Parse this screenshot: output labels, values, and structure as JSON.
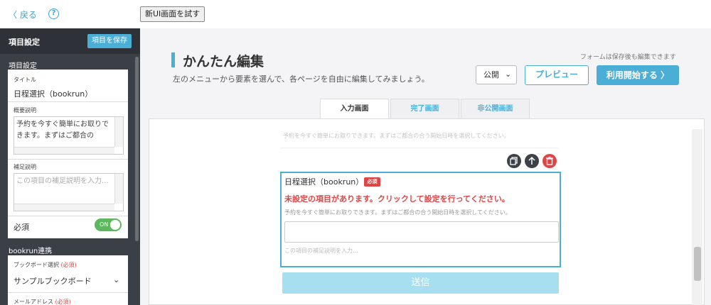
{
  "topbar": {
    "back_label": "〈 戻る",
    "help_icon": "question-circle-icon",
    "new_ui_button": "新UI画面を試す"
  },
  "sidebar": {
    "header_title": "項目設定",
    "save_button": "項目を保存",
    "section_item_settings": "項目設定",
    "title_label": "タイトル",
    "title_value": "日程選択（bookrun）",
    "summary_label": "概要説明",
    "summary_value": "予約を今すぐ簡単にお取りできます。まずはご都合の",
    "supplement_label": "補足説明",
    "supplement_placeholder": "この項目の補足説明を入力...",
    "required_label": "必須",
    "required_toggle": "ON",
    "section_bookrun": "bookrun連携",
    "bookboard_label": "ブックボード選択",
    "bookboard_required": "(必須)",
    "bookboard_value": "サンプルブックボード",
    "email_label": "メールアドレス",
    "email_required": "(必須)"
  },
  "main": {
    "title": "かんたん編集",
    "description": "左のメニューから要素を選んで、各ページを自由に編集してみましょう。",
    "note": "フォームは保存後も編集できます",
    "visibility_select": "公開",
    "preview_button": "プレビュー",
    "start_button": "利用開始する",
    "tabs": [
      {
        "label": "入力画面"
      },
      {
        "label": "完了画面"
      },
      {
        "label": "非公開画面"
      }
    ]
  },
  "form": {
    "faded_description": "予約を今すぐ簡単にお取りできます。まずはご都合の合う開始日時を選択してください。",
    "field_title": "日程選択（bookrun）",
    "field_badge": "必須",
    "error_message": "未設定の項目があります。クリックして設定を行ってください。",
    "field_description": "予約を今すぐ簡単にお取りできます。まずはご都合の合う開始日時を選択してください。",
    "supplement_placeholder": "この項目の補足説明を入力...",
    "submit_button": "送信",
    "icons": [
      "copy-icon",
      "arrow-up-icon",
      "trash-icon"
    ]
  },
  "colors": {
    "accent": "#4aaed6",
    "sidebar_bg": "#3b3f46",
    "error": "#e04545",
    "toggle_on": "#5cb85c"
  }
}
